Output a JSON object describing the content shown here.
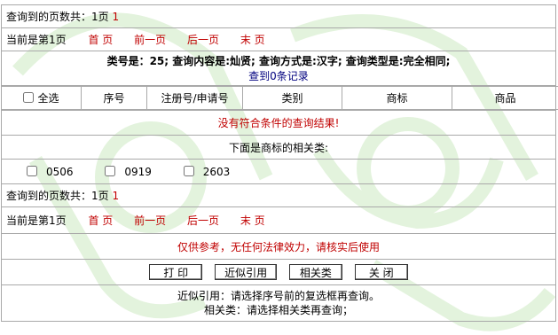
{
  "top_pager": {
    "total_label": "查询到的页数共：1页",
    "total_value": "1",
    "current_label": "当前是第1页",
    "links": [
      "首 页",
      "前一页",
      "后一页",
      "末 页"
    ]
  },
  "query_summary": {
    "line1": "类号是：25; 查询内容是:灿贤; 查询方式是:汉字; 查询类型是:完全相同;",
    "line2": "查到0条记录"
  },
  "table": {
    "headers": [
      "全选",
      "序号",
      "注册号/申请号",
      "类别",
      "商标",
      "商品"
    ]
  },
  "no_result": "没有符合条件的查询结果!",
  "related_title": "下面是商标的相关类:",
  "related_classes": [
    "0506",
    "0919",
    "2603"
  ],
  "bottom_pager": {
    "total_label": "查询到的页数共：1页",
    "total_value": "1",
    "current_label": "当前是第1页",
    "links": [
      "首 页",
      "前一页",
      "后一页",
      "末 页"
    ]
  },
  "disclaimer": "仅供参考，无任何法律效力，请核实后使用",
  "buttons": [
    "打 印",
    "近似引用",
    "相关类",
    "关 闭"
  ],
  "notes": [
    "近似引用：请选择序号前的复选框再查询。",
    "相关类：请选择相关类再查询；"
  ],
  "colors": {
    "link_red": "#c00000",
    "border": "#a9a9a9",
    "watermark": "#d8f0d0"
  }
}
